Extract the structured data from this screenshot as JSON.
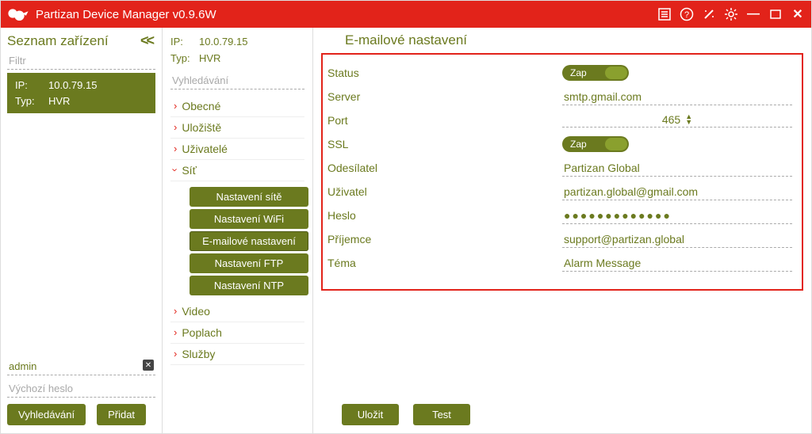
{
  "app": {
    "title": "Partizan Device Manager v0.9.6W"
  },
  "left": {
    "header": "Seznam zařízení",
    "collapse_glyph": "<<",
    "filter_placeholder": "Filtr",
    "device": {
      "ip_label": "IP:",
      "ip": "10.0.79.15",
      "type_label": "Typ:",
      "type": "HVR"
    },
    "user_value": "admin",
    "pass_placeholder": "Výchozí heslo",
    "btn_search": "Vyhledávání",
    "btn_add": "Přidat"
  },
  "mid": {
    "ip_label": "IP:",
    "ip": "10.0.79.15",
    "type_label": "Typ:",
    "type": "HVR",
    "search_placeholder": "Vyhledávání",
    "items": {
      "obecne": "Obecné",
      "uloziste": "Uložiště",
      "uzivatele": "Uživatelé",
      "sit": "Síť",
      "video": "Video",
      "poplach": "Poplach",
      "sluzby": "Služby"
    },
    "sit_sub": {
      "net": "Nastavení sítě",
      "wifi": "Nastavení WiFi",
      "email": "E-mailové nastavení",
      "ftp": "Nastavení FTP",
      "ntp": "Nastavení NTP"
    }
  },
  "main": {
    "title": "E-mailové nastavení",
    "toggle_on": "Zap",
    "labels": {
      "status": "Status",
      "server": "Server",
      "port": "Port",
      "ssl": "SSL",
      "sender": "Odesílatel",
      "user": "Uživatel",
      "password": "Heslo",
      "recipient": "Příjemce",
      "subject": "Téma"
    },
    "values": {
      "server": "smtp.gmail.com",
      "port": "465",
      "sender": "Partizan Global",
      "user": "partizan.global@gmail.com",
      "password": "●●●●●●●●●●●●●",
      "recipient": "support@partizan.global",
      "subject": "Alarm Message"
    },
    "btn_save": "Uložit",
    "btn_test": "Test"
  }
}
